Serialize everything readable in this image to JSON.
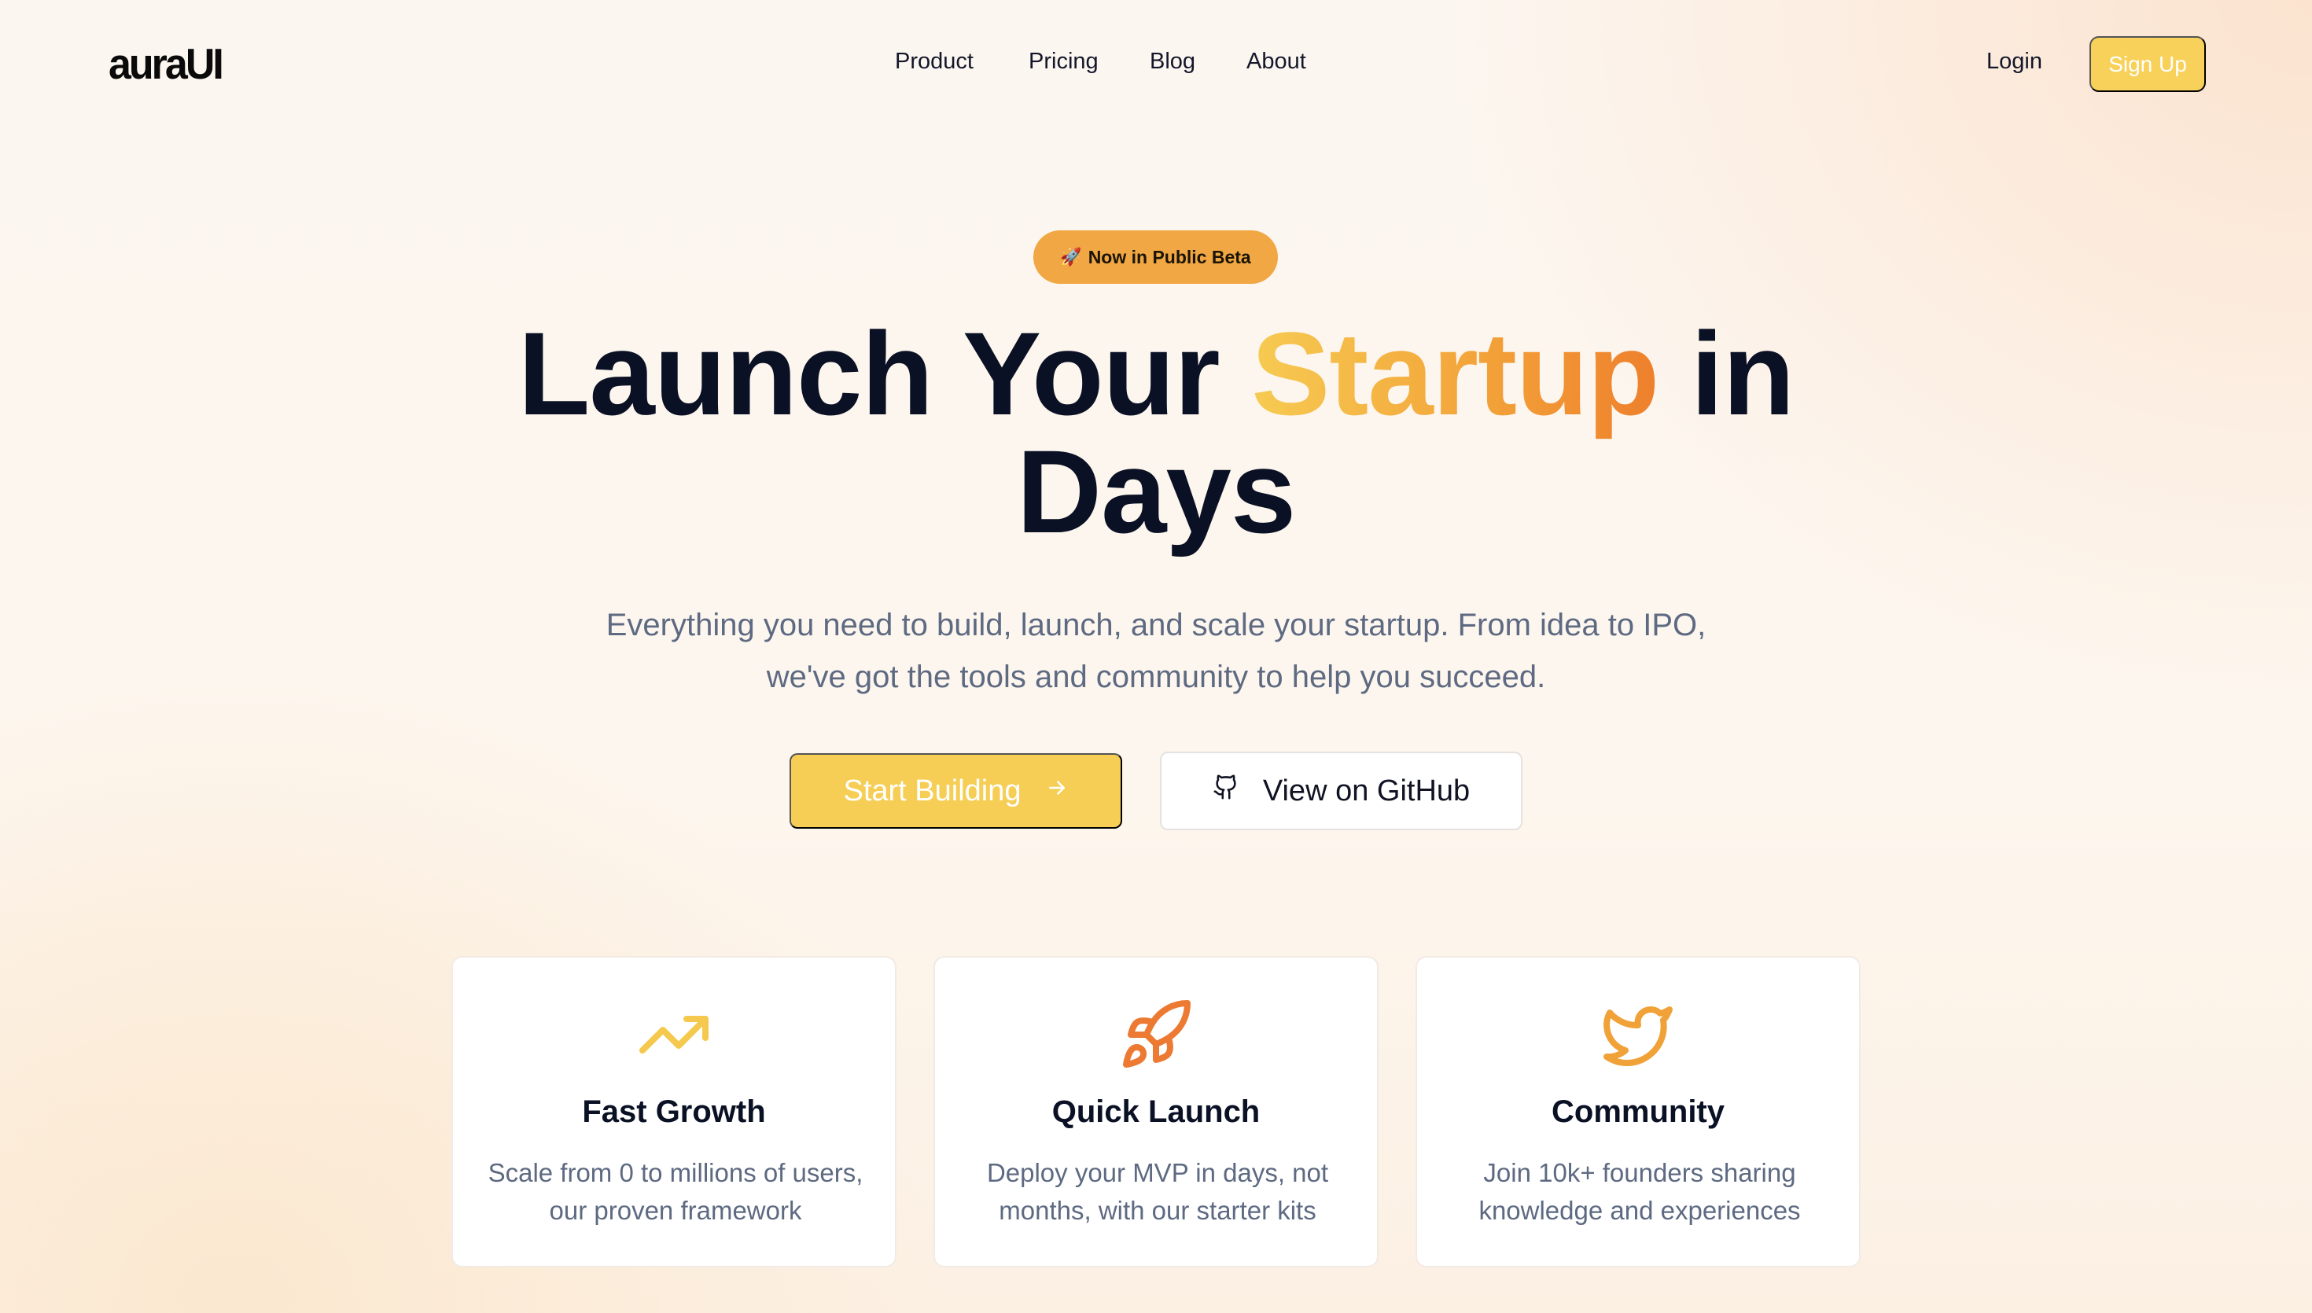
{
  "nav": {
    "logo": "auraUI",
    "links": [
      "Product",
      "Pricing",
      "Blog",
      "About"
    ],
    "login_label": "Login",
    "signup_label": "Sign Up"
  },
  "hero": {
    "badge_icon": "rocket-icon",
    "badge_text": "Now in Public Beta",
    "title_before": "Launch Your ",
    "title_highlight": "Startup",
    "title_after": " in",
    "title_line2": "Days",
    "subtitle": "Everything you need to build, launch, and scale your startup. From idea to IPO, we've got the tools and community to help you succeed.",
    "primary_cta": "Start Building",
    "secondary_cta": "View on GitHub"
  },
  "features": [
    {
      "icon": "trending-up-icon",
      "title": "Fast Growth",
      "description": "Scale from 0 to millions of users, our proven framework"
    },
    {
      "icon": "rocket-icon",
      "title": "Quick Launch",
      "description": "Deploy your MVP in days, not months, with our starter kits"
    },
    {
      "icon": "twitter-icon",
      "title": "Community",
      "description": "Join 10k+ founders sharing knowledge and experiences"
    }
  ],
  "colors": {
    "accent_yellow": "#f6ce55",
    "accent_orange": "#f1a743",
    "text_dark": "#0b1124",
    "text_muted": "#5e6a82"
  }
}
